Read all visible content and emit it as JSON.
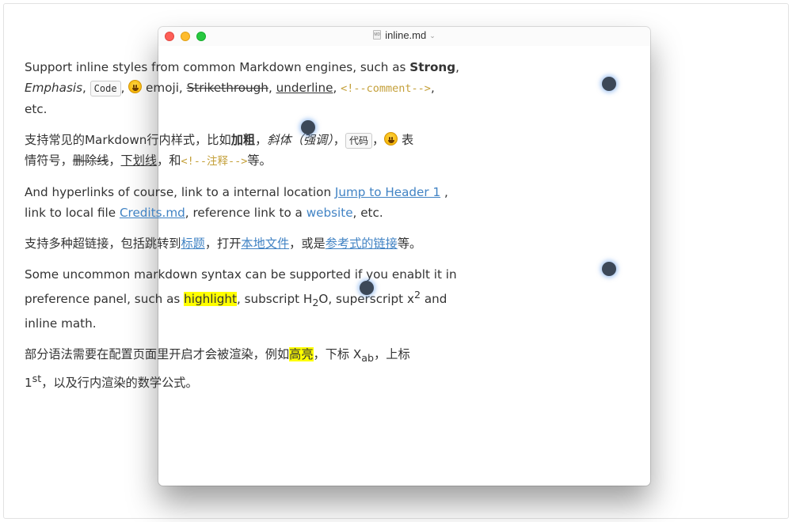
{
  "window": {
    "title": "inline.md",
    "doc_icon_text": "MD"
  },
  "paragraphs": {
    "p1": {
      "t1": "Support inline styles from common Markdown engines, such as ",
      "strong": "Strong",
      "t2": ",",
      "em": "Emphasis",
      "t3": ", ",
      "code": "Code",
      "t4": ", ",
      "t5": " emoji, ",
      "strike": "Strikethrough",
      "t6": ", ",
      "underline": "underline",
      "t7": ", ",
      "comment": "<!--comment-->",
      "t8": ",",
      "t9": "etc."
    },
    "p2": {
      "t1": "支持常见的Markdown行内样式，比如",
      "strong": "加粗",
      "t2": "，",
      "em": "斜体（强调）",
      "t3": "，",
      "code": "代码",
      "t4": "，",
      "t5": " 表",
      "t6": "情符号，",
      "strike": "删除线",
      "t7": "，",
      "underline": "下划线",
      "t8": "，和",
      "comment": "<!--注释-->",
      "t9": "等。"
    },
    "p3": {
      "t1": "And hyperlinks of course, link to a internal location ",
      "link1": "Jump to Header 1",
      "t2": " ,",
      "t3": "link to local file ",
      "link2": "Credits.md",
      "t4": ", reference link to a ",
      "link3": "website",
      "t5": ", etc."
    },
    "p4": {
      "t1": "支持多种超链接，包括跳转到",
      "link1": "标题",
      "t2": "，打开",
      "link2": "本地文件",
      "t3": "，或是",
      "link3": "参考式的链接",
      "t4": "等。"
    },
    "p5": {
      "t1": "Some uncommon markdown syntax can be supported if you enablt it in",
      "t2": "preference panel, such as ",
      "mark": "highlight",
      "t3": ", subscript H",
      "sub": "2",
      "t4": "O, superscript x",
      "sup": "2",
      "t5": " and",
      "t6": "inline math."
    },
    "p6": {
      "t1": "部分语法需要在配置页面里开启才会被渲染，例如",
      "mark": "高亮",
      "t2": "，下标 X",
      "sub": "ab",
      "t3": "，上标",
      "t4": "1",
      "sup": "st",
      "t5": "，以及行内渲染的数学公式。"
    }
  },
  "colors": {
    "link": "#4183c4",
    "comment": "#c4a03a",
    "highlight": "#ffff00",
    "text": "#333333"
  },
  "icons": {
    "emoji": "grinning-face-emoji",
    "doc": "markdown-file-icon"
  }
}
